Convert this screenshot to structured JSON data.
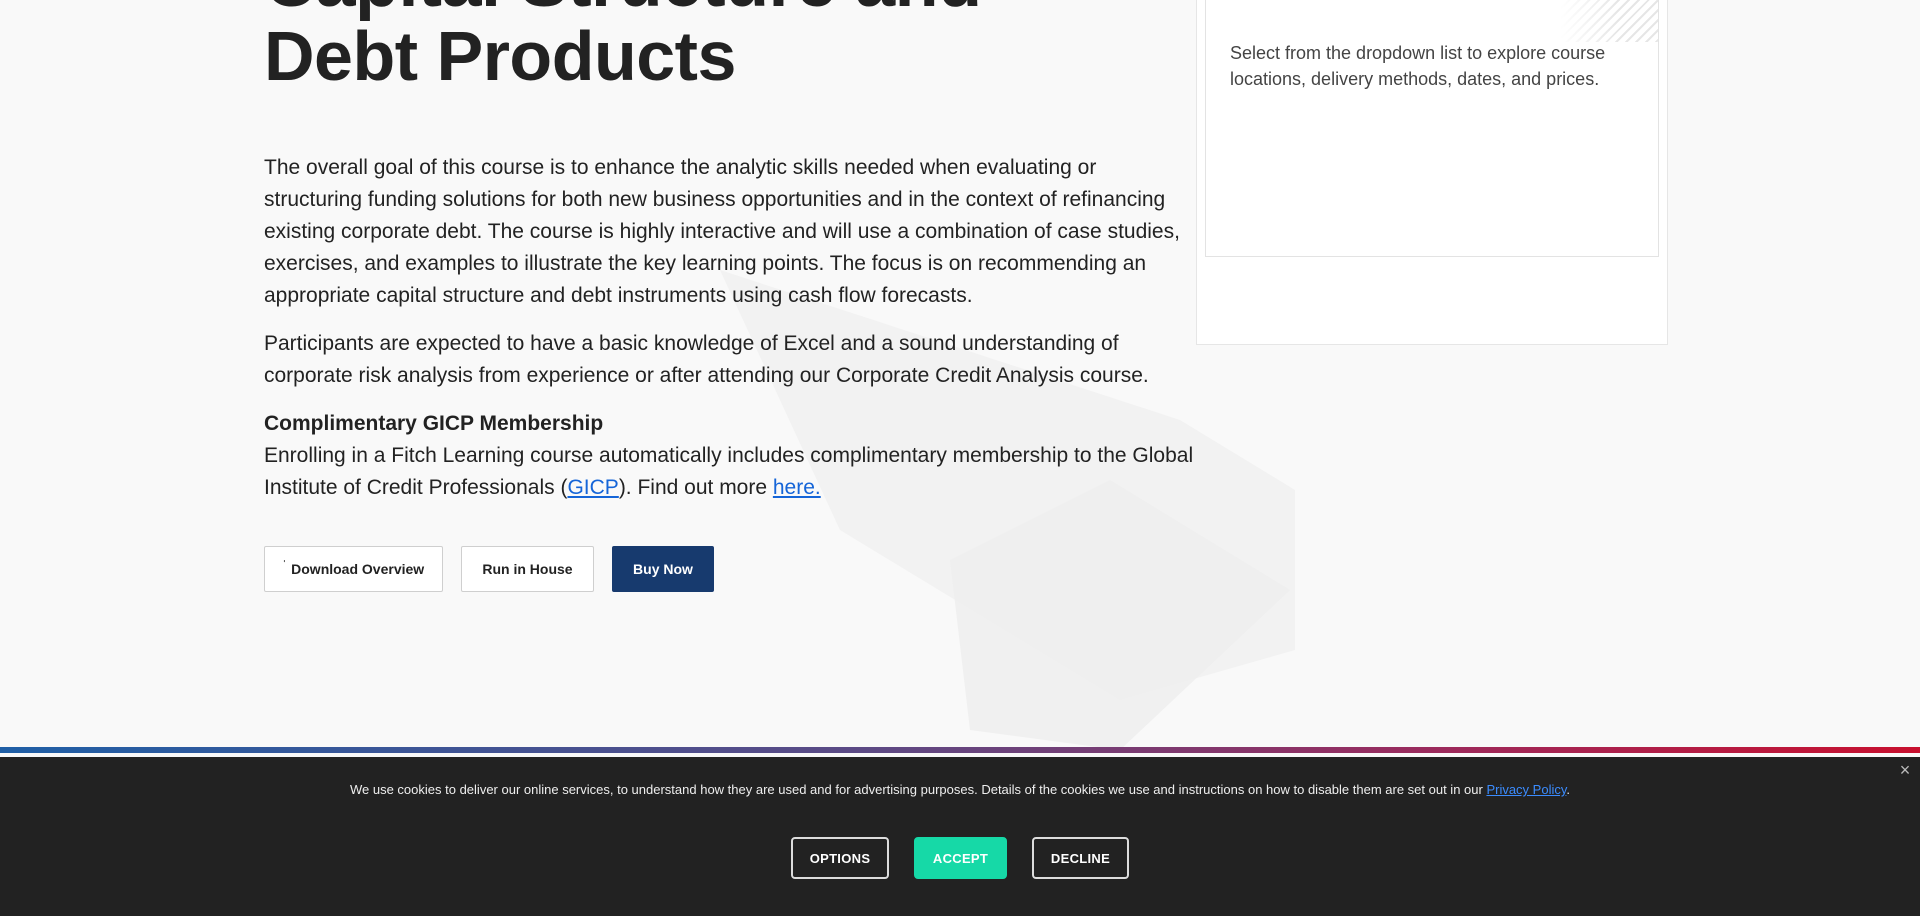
{
  "course": {
    "title_line_partial": "Capital Structure and",
    "title_line": "Debt Products",
    "paragraph_1": "The overall goal of this course is to enhance the analytic skills needed when evaluating or structuring funding solutions for both new business opportunities and in the context of refinancing existing corporate debt. The course is highly interactive and will use a combination of case studies, exercises, and examples to illustrate the key learning points. The focus is on recommending an appropriate capital structure and debt instruments using cash flow forecasts.",
    "paragraph_2": "Participants are expected to have a basic knowledge of Excel and a sound understanding of corporate risk analysis from experience or after attending our Corporate Credit Analysis course.",
    "membership_title": "Complimentary GICP Membership",
    "membership_text_before": "Enrolling in a Fitch Learning course automatically includes complimentary membership to the Global Institute of Credit Professionals (",
    "membership_link_gicp": "GICP",
    "membership_text_middle": "). Find out more ",
    "membership_link_here": "here."
  },
  "actions": {
    "download_icon": "download-icon",
    "download_label": "Download Overview",
    "run_in_house_label": "Run in House",
    "buy_now_label": "Buy Now"
  },
  "sidebar": {
    "helper_text": "Select from the dropdown list to explore course locations, delivery methods, dates, and prices."
  },
  "cookie_banner": {
    "message": "We use cookies to deliver our online services, to understand how they are used and for advertising purposes. Details of the cookies we use and instructions on how to disable them are set out in our ",
    "policy_link": "Privacy Policy",
    "message_end": ".",
    "options_label": "OPTIONS",
    "accept_label": "ACCEPT",
    "decline_label": "DECLINE",
    "close_icon": "close-icon"
  },
  "colors": {
    "primary_button": "#173a6e",
    "accept_button": "#16d9a7",
    "link": "#1565d8",
    "banner_bg": "#222222"
  }
}
